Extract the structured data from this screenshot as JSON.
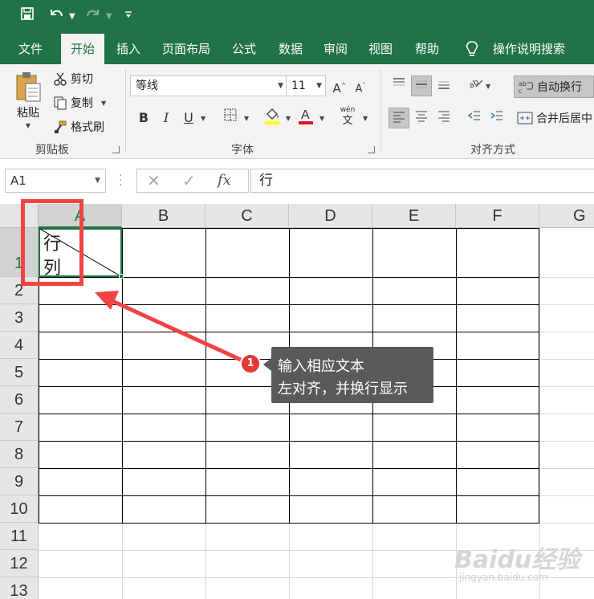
{
  "quick_access": {
    "save_icon": "save-icon",
    "undo_icon": "undo-icon",
    "redo_icon": "redo-icon",
    "customize_icon": "customize-qat-icon"
  },
  "ribbon_tabs": [
    {
      "label": "文件"
    },
    {
      "label": "开始",
      "active": true
    },
    {
      "label": "插入"
    },
    {
      "label": "页面布局"
    },
    {
      "label": "公式"
    },
    {
      "label": "数据"
    },
    {
      "label": "审阅"
    },
    {
      "label": "视图"
    },
    {
      "label": "帮助"
    }
  ],
  "tell_me": "操作说明搜索",
  "clipboard": {
    "paste": "粘贴",
    "cut": "剪切",
    "copy": "复制",
    "format_painter": "格式刷",
    "group_label": "剪贴板"
  },
  "font": {
    "name": "等线",
    "size": "11",
    "bold": "B",
    "italic": "I",
    "underline": "U",
    "group_label": "字体",
    "phonetic": "wén",
    "phonetic_char": "文",
    "highlight_color": "#ffff00",
    "font_color": "#e81123"
  },
  "alignment": {
    "wrap_text": "自动换行",
    "merge_center": "合并后居中",
    "group_label": "对齐方式"
  },
  "formula_bar": {
    "name_box": "A1",
    "fx": "fx",
    "content": "行"
  },
  "sheet": {
    "columns": [
      "A",
      "B",
      "C",
      "D",
      "E",
      "F",
      "G"
    ],
    "rows": [
      "1",
      "2",
      "3",
      "4",
      "5",
      "6",
      "7",
      "8",
      "9",
      "10",
      "11",
      "12",
      "13"
    ],
    "selected_cell": "A1",
    "a1_line1": "行",
    "a1_line2": "列"
  },
  "annotation": {
    "badge": "1",
    "line1": "输入相应文本",
    "line2": "左对齐，并换行显示",
    "color": "#ef4444"
  },
  "watermark": {
    "logo": "Baidu经验",
    "url": "jingyan.baidu.com"
  },
  "colors": {
    "brand": "#217346",
    "ribbon_bg": "#f3f3f3"
  }
}
